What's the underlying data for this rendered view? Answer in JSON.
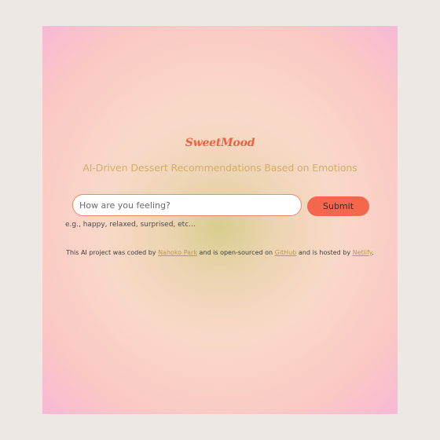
{
  "header": {
    "logo_text": "SweetMood",
    "subtitle": "AI-Driven Dessert Recommendations Based on Emotions"
  },
  "form": {
    "input_placeholder": "How are you feeling?",
    "input_value": "",
    "submit_label": "Submit",
    "hint": "e.g., happy, relaxed, surprised, etc..."
  },
  "footer": {
    "text_1": "This AI project was coded by ",
    "author_link": "Nahoko Park",
    "text_2": " and is open-sourced on ",
    "github_link": "GitHub",
    "text_3": " and is hosted by ",
    "netlify_link": "Netlify",
    "text_4": "."
  },
  "colors": {
    "page_background": "#ede8e4",
    "brand_accent": "#f05f43",
    "submit_button": "#f4674d",
    "subtitle_text": "#d3ad6a",
    "link": "#b79a55"
  }
}
